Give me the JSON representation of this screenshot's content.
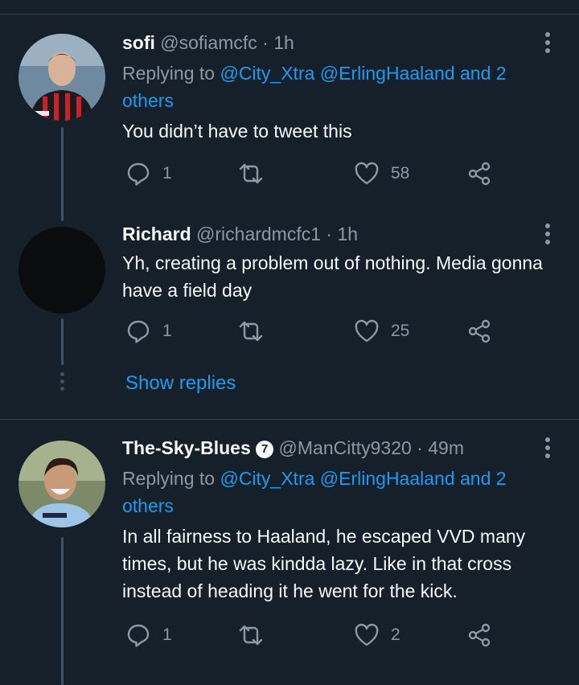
{
  "tweets": [
    {
      "name": "sofi",
      "handle": "@sofiamcfc",
      "time": "· 1h",
      "replying_prefix": "Replying to",
      "replying_links": "@City_Xtra @ErlingHaaland and 2 others",
      "text": "You didn’t have to tweet this",
      "replies": "1",
      "retweets": "",
      "likes": "58",
      "avatar": "footballer-red-black-kit-photo"
    },
    {
      "name": "Richard",
      "handle": "@richardmcfc1",
      "time": "· 1h",
      "text": "Yh, creating a problem out of nothing. Media gonna have a field day",
      "replies": "1",
      "retweets": "",
      "likes": "25",
      "avatar": "dark-avatar"
    },
    {
      "name": "The-Sky-Blues",
      "badge": "7",
      "handle": "@ManCitty9320",
      "time": "· 49m",
      "replying_prefix": "Replying to",
      "replying_links": "@City_Xtra @ErlingHaaland and 2 others",
      "text": "In all fairness to Haaland, he escaped VVD many times, but he was kindda lazy. Like in that cross instead of heading it he went for the kick.",
      "replies": "1",
      "retweets": "",
      "likes": "2",
      "avatar": "smiling-player-photo"
    }
  ],
  "show_replies": "Show replies",
  "icons": [
    "reply-icon",
    "retweet-icon",
    "like-icon",
    "share-icon",
    "more-icon"
  ],
  "colors": {
    "background": "#15202b",
    "link": "#1d9bf0",
    "muted": "#8b98a5",
    "divider": "#38444d"
  }
}
